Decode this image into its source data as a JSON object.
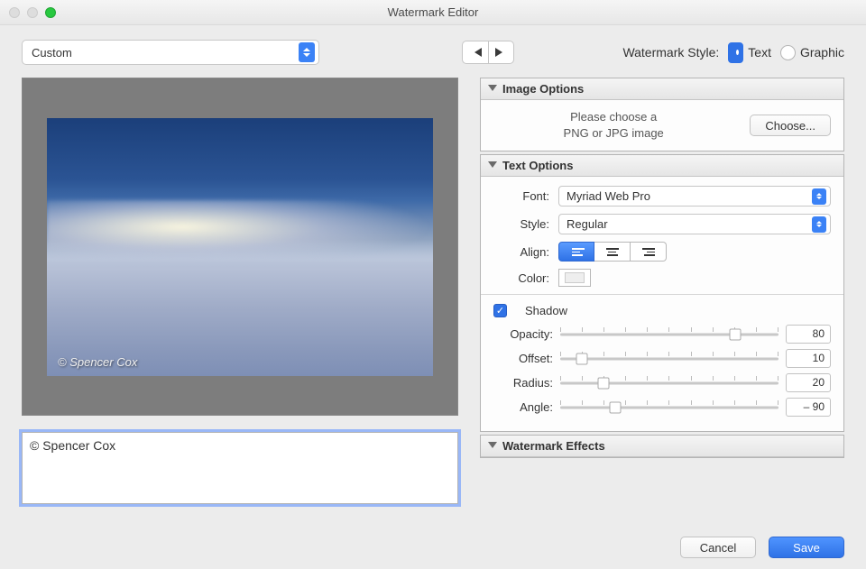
{
  "window": {
    "title": "Watermark Editor"
  },
  "preset": {
    "selected": "Custom"
  },
  "nav": {
    "prev": "◀",
    "next": "▶"
  },
  "style": {
    "label": "Watermark Style:",
    "text": "Text",
    "graphic": "Graphic",
    "selected": "text"
  },
  "preview": {
    "watermark_text": "© Spencer Cox"
  },
  "watermark_input": "© Spencer Cox",
  "panels": {
    "image": {
      "title": "Image Options",
      "message_l1": "Please choose a",
      "message_l2": "PNG or JPG image",
      "choose": "Choose..."
    },
    "text": {
      "title": "Text Options",
      "font_label": "Font:",
      "font_value": "Myriad Web Pro",
      "style_label": "Style:",
      "style_value": "Regular",
      "align_label": "Align:",
      "color_label": "Color:",
      "shadow": {
        "checked": true,
        "label": "Shadow",
        "opacity_label": "Opacity:",
        "opacity_value": "80",
        "offset_label": "Offset:",
        "offset_value": "10",
        "radius_label": "Radius:",
        "radius_value": "20",
        "angle_label": "Angle:",
        "angle_value": "– 90"
      }
    },
    "effects": {
      "title": "Watermark Effects"
    }
  },
  "footer": {
    "cancel": "Cancel",
    "save": "Save"
  }
}
